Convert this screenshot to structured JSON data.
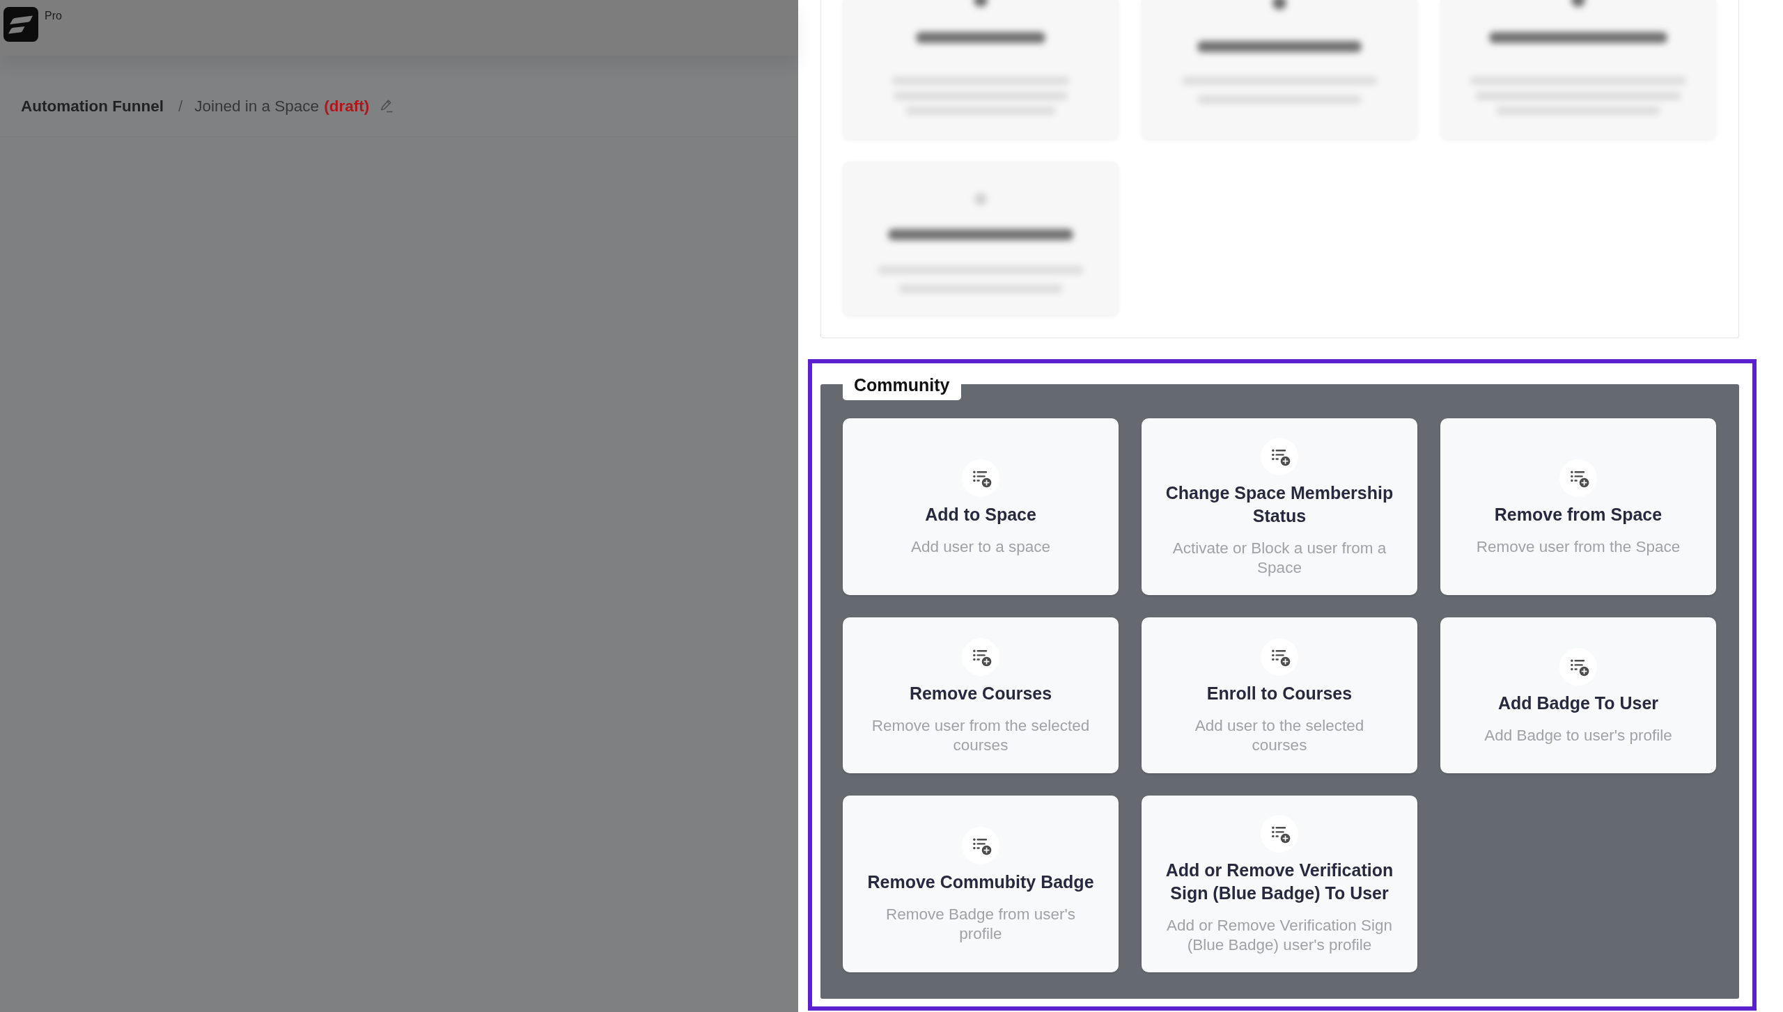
{
  "app": {
    "plan_badge": "Pro"
  },
  "breadcrumb": {
    "parent": "Automation Funnel",
    "separator": "/",
    "current": "Joined in a Space",
    "status": "(draft)"
  },
  "action_group": {
    "title": "Community",
    "highlighted": true,
    "actions": [
      {
        "title": "Add to Space",
        "description": "Add user to a space"
      },
      {
        "title": "Change Space Membership Status",
        "description": "Activate or Block a user from a Space"
      },
      {
        "title": "Remove from Space",
        "description": "Remove user from the Space"
      },
      {
        "title": "Remove Courses",
        "description": "Remove user from the selected courses"
      },
      {
        "title": "Enroll to Courses",
        "description": "Add user to the selected courses"
      },
      {
        "title": "Add Badge To User",
        "description": "Add Badge to user's profile"
      },
      {
        "title": "Remove Commubity Badge",
        "description": "Remove Badge from user's profile"
      },
      {
        "title": "Add or Remove Verification Sign (Blue Badge) To User",
        "description": "Add or Remove Verification Sign (Blue Badge) user's profile"
      }
    ]
  }
}
